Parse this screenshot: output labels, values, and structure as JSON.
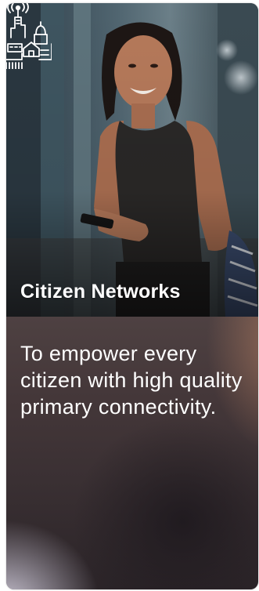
{
  "card": {
    "title": "Citizen Networks",
    "description": "To empower every citizen with high quality primary connectivity.",
    "icon": "smart-city-antenna-icon",
    "photo": "woman-smiling-holding-phone-photo"
  },
  "colors": {
    "title_text": "#ffffff",
    "description_text": "#ffffff",
    "description_background": "#433739"
  }
}
